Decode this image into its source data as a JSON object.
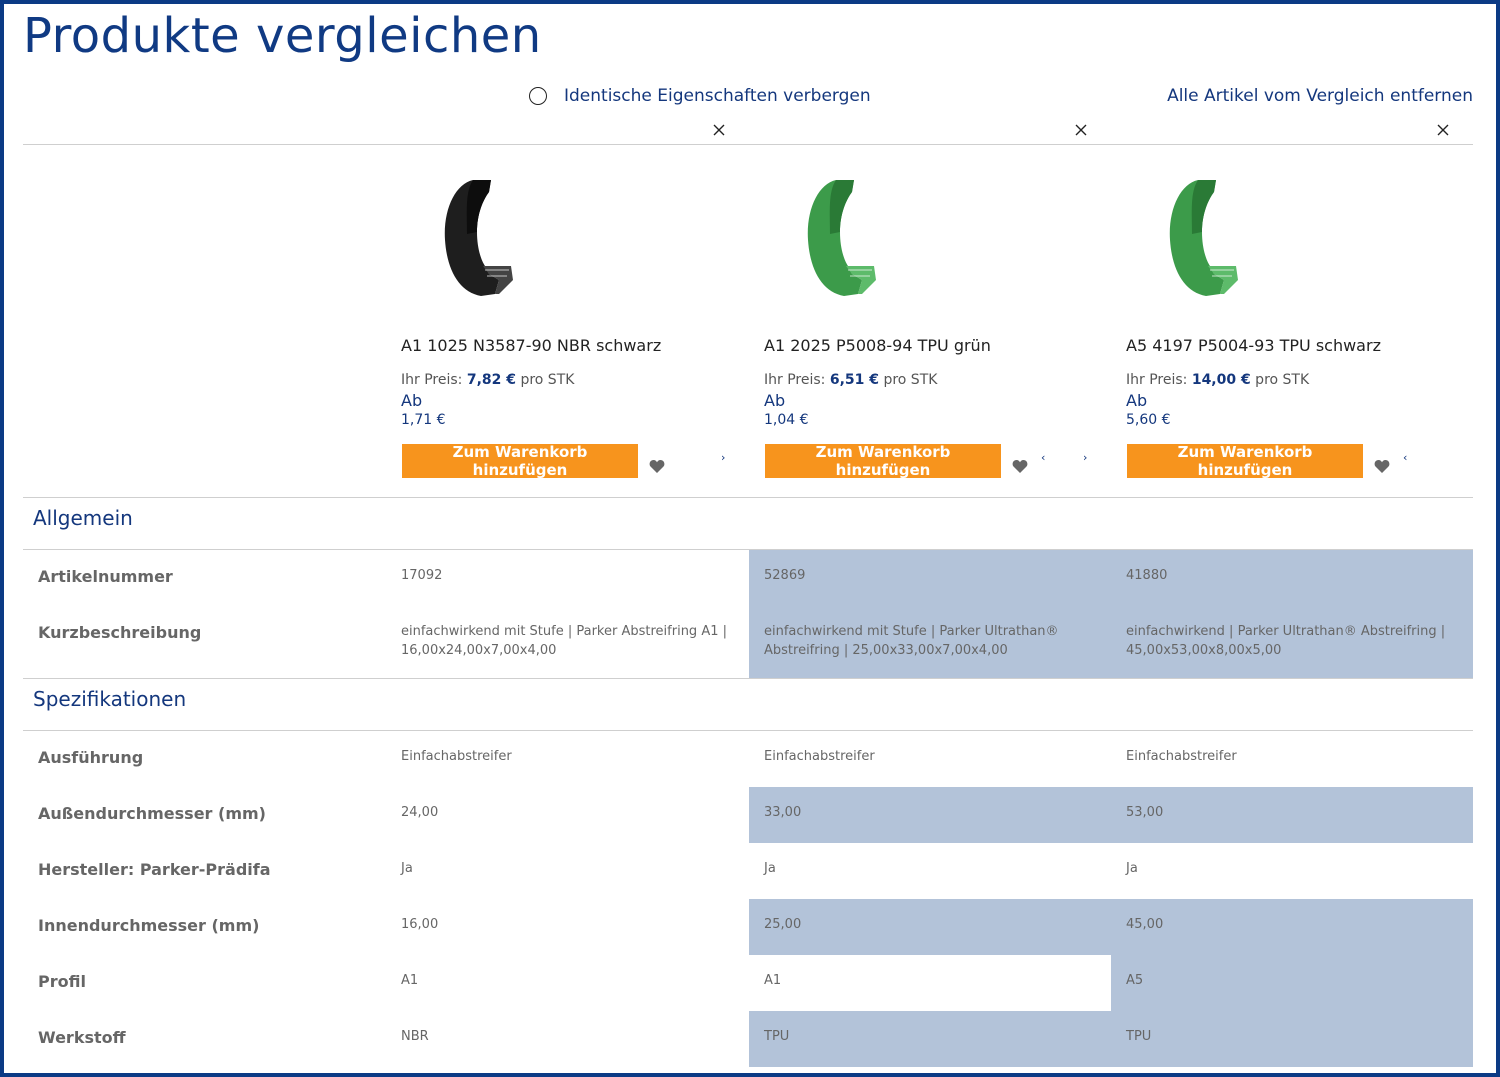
{
  "page": {
    "title": "Produkte vergleichen"
  },
  "toolbar": {
    "hide_identical_label": "Identische Eigenschaften verbergen",
    "remove_all_label": "Alle Artikel vom Vergleich entfernen"
  },
  "products": [
    {
      "name": "A1 1025 N3587-90 NBR schwarz",
      "price_prefix": "Ihr Preis: ",
      "price": "7,82 €",
      "price_unit": " pro STK",
      "ab_label": "Ab",
      "ab_price": "1,71 €",
      "cart_label": "Zum Warenkorb hinzufügen",
      "image_color": "#1e1e1e",
      "image_color_dark": "#0d0d0d",
      "image_color_light": "#444444"
    },
    {
      "name": "A1 2025 P5008-94 TPU grün",
      "price_prefix": "Ihr Preis: ",
      "price": "6,51 €",
      "price_unit": " pro STK",
      "ab_label": "Ab",
      "ab_price": "1,04 €",
      "cart_label": "Zum Warenkorb hinzufügen",
      "image_color": "#3c9b4a",
      "image_color_dark": "#2a7a36",
      "image_color_light": "#5dbb6a"
    },
    {
      "name": "A5 4197 P5004-93 TPU schwarz",
      "price_prefix": "Ihr Preis: ",
      "price": "14,00 €",
      "price_unit": " pro STK",
      "ab_label": "Ab",
      "ab_price": "5,60 €",
      "cart_label": "Zum Warenkorb hinzufügen",
      "image_color": "#3c9b4a",
      "image_color_dark": "#2a7a36",
      "image_color_light": "#5dbb6a"
    }
  ],
  "sections": [
    {
      "title": "Allgemein",
      "rows": [
        {
          "label": "Artikelnummer",
          "values": [
            "17092",
            "52869",
            "41880"
          ]
        },
        {
          "label": "Kurzbeschreibung",
          "values": [
            "einfachwirkend mit Stufe | Parker Abstreifring A1 | 16,00x24,00x7,00x4,00",
            "einfachwirkend mit Stufe | Parker Ultrathan® Abstreifring | 25,00x33,00x7,00x4,00",
            "einfachwirkend | Parker Ultrathan® Abstreifring | 45,00x53,00x8,00x5,00"
          ]
        }
      ]
    },
    {
      "title": "Spezifikationen",
      "rows": [
        {
          "label": "Ausführung",
          "values": [
            "Einfachabstreifer",
            "Einfachabstreifer",
            "Einfachabstreifer"
          ]
        },
        {
          "label": "Außendurchmesser (mm)",
          "values": [
            "24,00",
            "33,00",
            "53,00"
          ]
        },
        {
          "label": "Hersteller: Parker-Prädifa",
          "values": [
            "Ja",
            "Ja",
            "Ja"
          ]
        },
        {
          "label": "Innendurchmesser (mm)",
          "values": [
            "16,00",
            "25,00",
            "45,00"
          ]
        },
        {
          "label": "Profil",
          "values": [
            "A1",
            "A1",
            "A5"
          ]
        },
        {
          "label": "Werkstoff",
          "values": [
            "NBR",
            "TPU",
            "TPU"
          ]
        }
      ]
    }
  ],
  "icons": {
    "close": "close-icon",
    "favorite": "heart-icon",
    "carousel_next": "chevron-right-icon",
    "carousel_prev": "chevron-left-icon",
    "toggle": "radio-icon"
  },
  "colors": {
    "brand": "#14377d",
    "button": "#f7941d",
    "highlight": "#b3c3d9"
  }
}
